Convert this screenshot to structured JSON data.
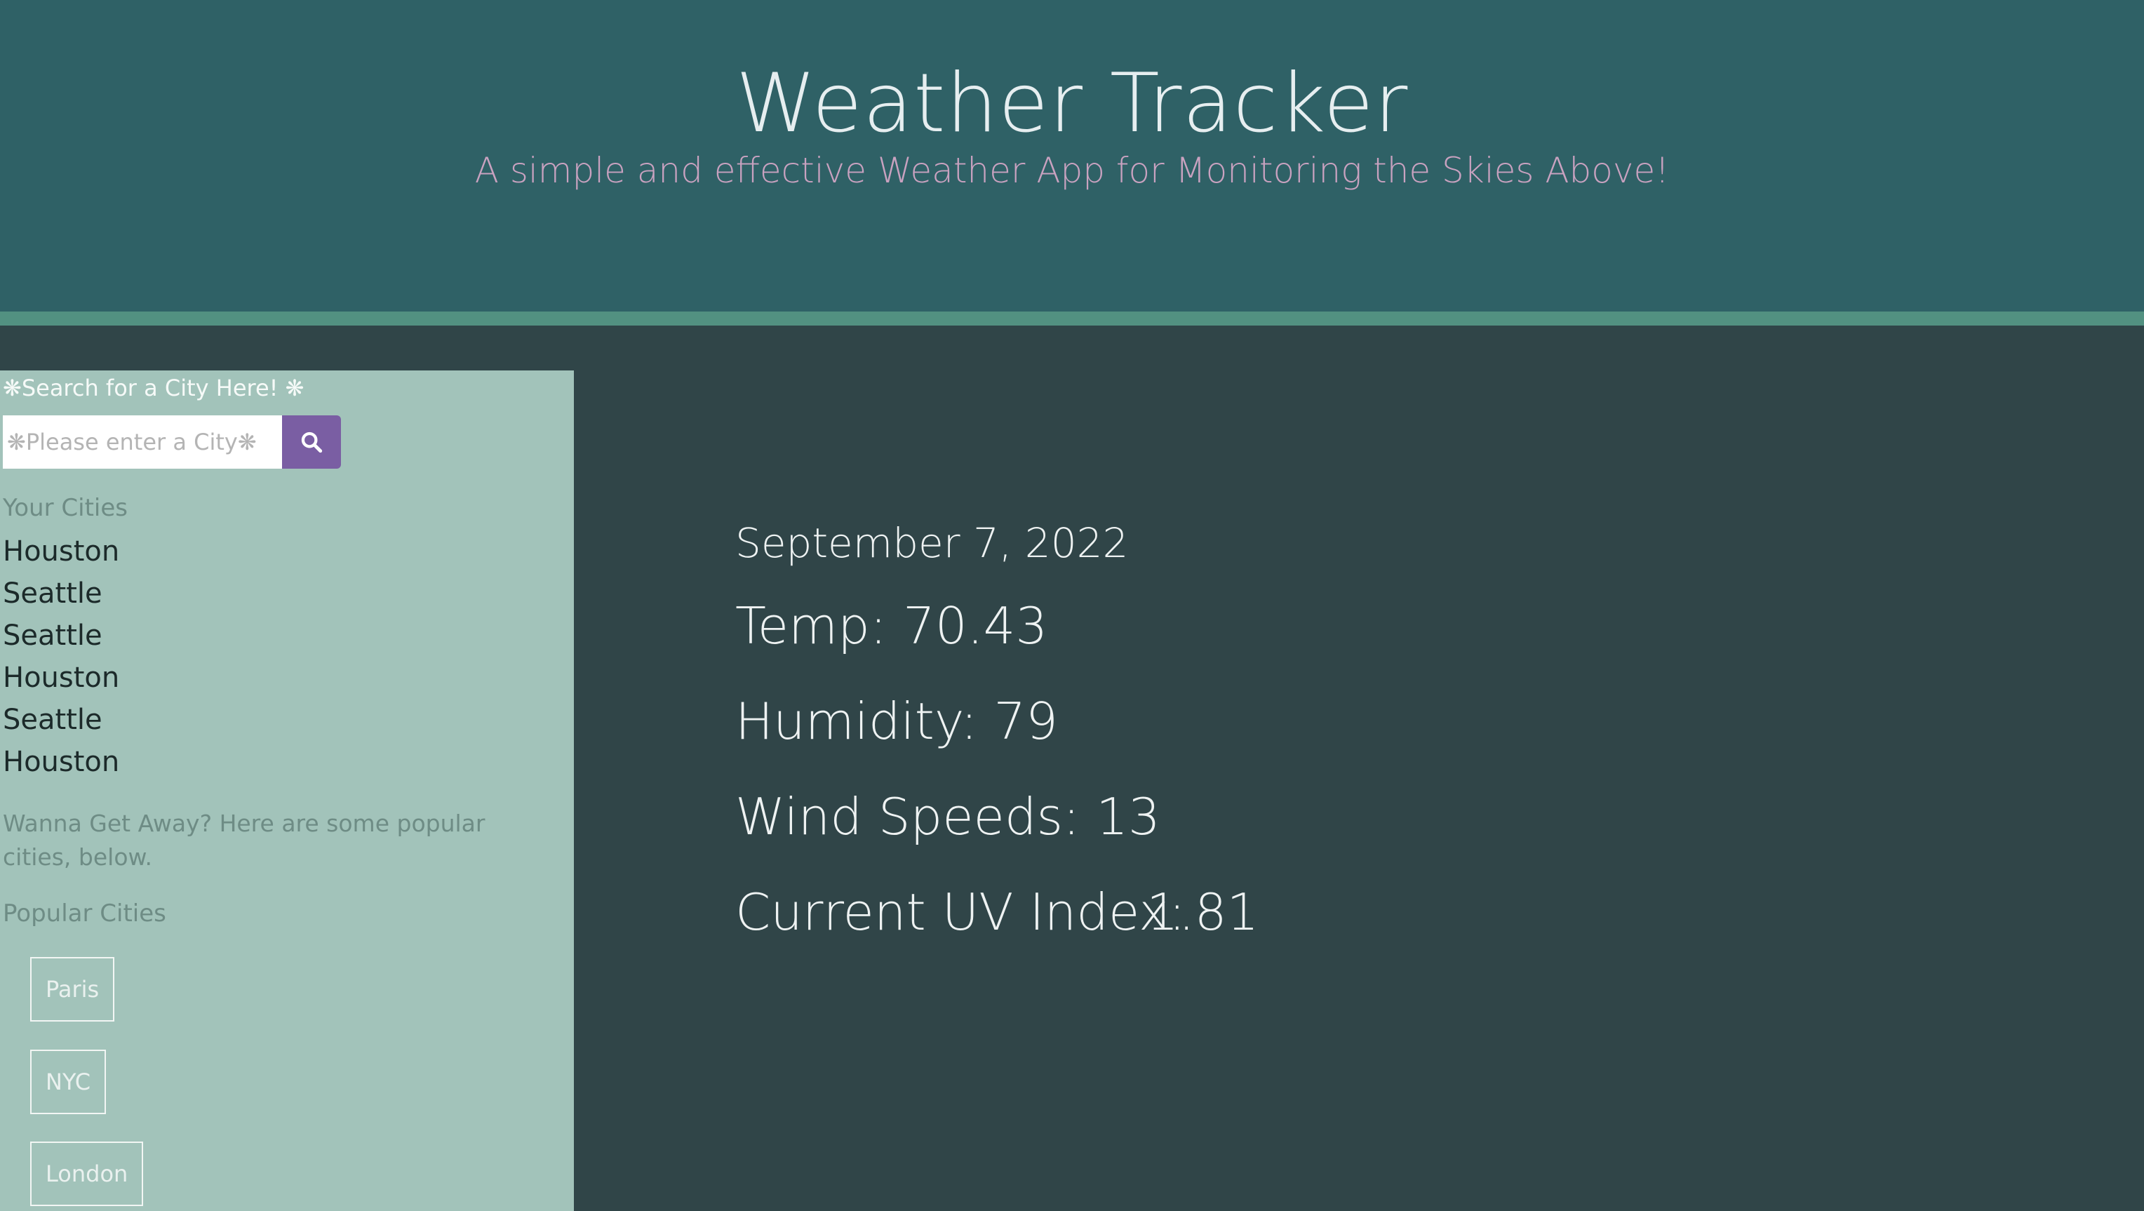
{
  "header": {
    "title": "Weather Tracker",
    "subtitle": "A simple and effective Weather App for Monitoring the Skies Above!"
  },
  "sidebar": {
    "search_label": "❋Search for a City Here! ❋",
    "search_placeholder": "❋Please enter a City❋",
    "search_icon": "search-icon",
    "your_cities_label": "Your Cities",
    "cities": [
      "Houston",
      "Seattle",
      "Seattle",
      "Houston",
      "Seattle",
      "Houston"
    ],
    "getaway_text": "Wanna Get Away? Here are some popular cities, below.",
    "popular_label": "Popular Cities",
    "popular": [
      "Paris",
      "NYC",
      "London"
    ]
  },
  "weather": {
    "date": "September 7, 2022",
    "temp": "Temp: 70.43",
    "humidity": "Humidity: 79",
    "wind": "Wind Speeds: 13",
    "uv_label": "Current UV Index:",
    "uv_value": "1.81"
  },
  "colors": {
    "header_bg": "#2f6166",
    "accent_bar": "#529181",
    "main_bg": "#304548",
    "sidebar_bg": "#a2c3ba",
    "search_button": "#7a5ea3",
    "subtitle": "#c9a2c0"
  }
}
